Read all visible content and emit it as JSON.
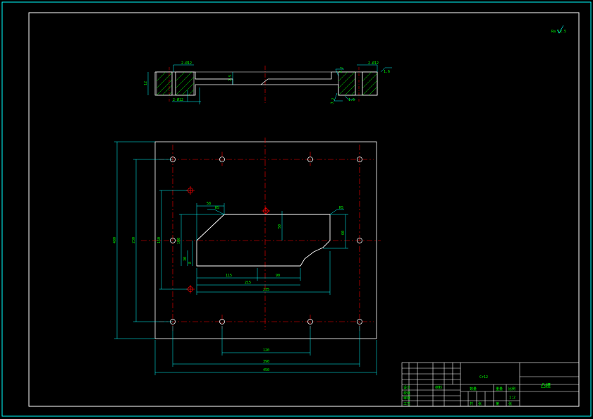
{
  "drawing": {
    "colors": {
      "background": "#000000",
      "border": "#00ffff",
      "outline": "#ffffff",
      "centerline": "#ff0000",
      "dimension": "#00ffff",
      "text": "#00ff00",
      "hatch": "#00ff00",
      "marker": "#ff0000"
    },
    "roughness_note": "Ra 12.5",
    "section_view": {
      "dimensions": {
        "hole_callout_top_left": "2-Ø12",
        "hole_callout_top_right": "2-Ø12",
        "hole_callout_bottom": "2-Ø12",
        "thickness": "12",
        "pocket_depth": "2.5",
        "chamfer_top": "3.2",
        "chamfer_bottom": "3.2",
        "angle_top_right": "1.6",
        "angle_bottom_right": "1.6"
      }
    },
    "plan_view": {
      "dimensions": {
        "overall_height": "480",
        "hole_spacing_vertical": "230",
        "pin_spacing_vertical": "150",
        "pocket_height": "100",
        "pocket_offset": "30",
        "left_step": "8",
        "pocket_depth_center": "50",
        "pocket_right_height": "60",
        "chamfer_top_left": "R5",
        "chamfer_top_right": "R5",
        "top_width": "58",
        "bottom_left": "115",
        "bottom_mid": "90",
        "bottom_inner": "215",
        "bottom_overall": "235",
        "hole_spacing_mid": "120",
        "hole_spacing_horizontal": "390",
        "overall_width": "450"
      }
    },
    "title_block": {
      "part_name": "凸模",
      "material": "Cr12",
      "scale_label": "比例",
      "row_labels": [
        "设计",
        "校核",
        "审核",
        "工艺"
      ],
      "qty_labels": [
        "数量",
        "重量",
        "材料"
      ],
      "sheet_labels": [
        "共",
        "张",
        "第",
        "张"
      ],
      "scale_value": "1:2"
    }
  }
}
